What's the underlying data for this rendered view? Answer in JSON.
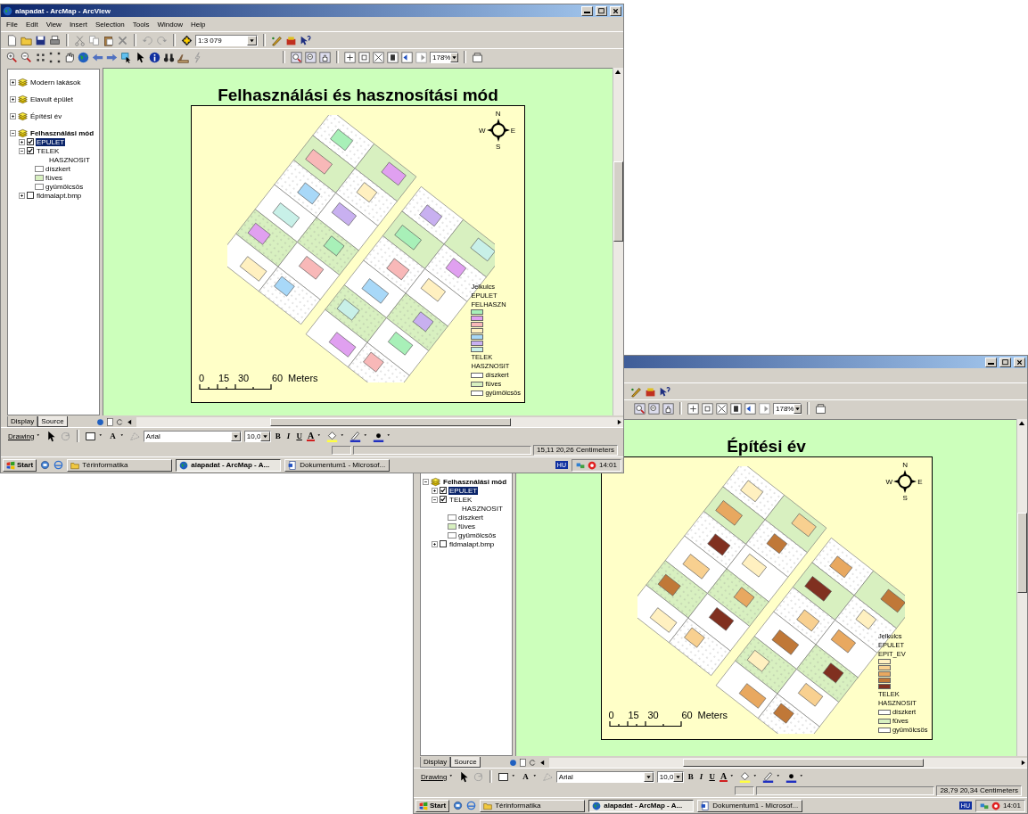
{
  "windows": [
    {
      "kind": "front",
      "title": "alapadat - ArcMap - ArcView",
      "menu": [
        "File",
        "Edit",
        "View",
        "Insert",
        "Selection",
        "Tools",
        "Window",
        "Help"
      ],
      "scale": "1:3 079",
      "zoom": "178%",
      "toc": [
        {
          "label": "Modern lakások",
          "kind": "frame",
          "expanded": false,
          "active": false
        },
        {
          "label": "Elavult épület",
          "kind": "frame",
          "expanded": false,
          "active": false
        },
        {
          "label": "Építési év",
          "kind": "frame",
          "expanded": false,
          "active": false
        },
        {
          "label": "Felhasználási mód",
          "kind": "frame",
          "expanded": true,
          "active": true,
          "children": [
            {
              "label": "EPULET",
              "kind": "layer",
              "expanded": false,
              "checked": true,
              "selected": true
            },
            {
              "label": "TELEK",
              "kind": "layer",
              "expanded": true,
              "checked": true,
              "selected": false,
              "children": [
                {
                  "kind": "heading",
                  "label": "HASZNOSIT"
                },
                {
                  "kind": "class",
                  "label": "díszkert",
                  "color": "#ffffff"
                },
                {
                  "kind": "class",
                  "label": "füves",
                  "color": "#d8f0c0"
                },
                {
                  "kind": "class",
                  "label": "gyümölcsös",
                  "color": "#ffffff"
                }
              ]
            },
            {
              "label": "fldmalapt.bmp",
              "kind": "layer",
              "expanded": false,
              "checked": false,
              "selected": false
            }
          ]
        }
      ],
      "toc_tabs": [
        {
          "label": "Display",
          "selected": false
        },
        {
          "label": "Source",
          "selected": true
        }
      ],
      "map_title": "Felhasználási és hasznosítási mód",
      "north_arrow": {
        "n": "N",
        "w": "W",
        "e": "E",
        "s": "S"
      },
      "scale_bar": [
        "0",
        "15",
        "30",
        "60",
        "Meters"
      ],
      "legend": [
        {
          "kind": "title",
          "label": "Jelkulcs"
        },
        {
          "kind": "heading",
          "label": "EPULET"
        },
        {
          "kind": "heading",
          "label": "FELHASZN"
        },
        {
          "kind": "swatch",
          "color": "#a8f0b8"
        },
        {
          "kind": "swatch",
          "color": "#e0a0f0"
        },
        {
          "kind": "swatch",
          "color": "#f8b8b8"
        },
        {
          "kind": "swatch",
          "color": "#fff0c0"
        },
        {
          "kind": "swatch",
          "color": "#a8d8f8"
        },
        {
          "kind": "swatch",
          "color": "#c8b0f0"
        },
        {
          "kind": "swatch",
          "color": "#c8f0e8"
        },
        {
          "kind": "heading",
          "label": "TELEK"
        },
        {
          "kind": "heading",
          "label": "HASZNOSIT"
        },
        {
          "kind": "class",
          "label": "díszkert",
          "color": "#ffffff"
        },
        {
          "kind": "class",
          "label": "füves",
          "color": "#d8f0c0"
        },
        {
          "kind": "class",
          "label": "gyümölcsös",
          "color": "#ffffff"
        }
      ],
      "drawing": {
        "menu": "Drawing",
        "text_tool": "A",
        "font": "Arial",
        "size": "10,0",
        "styles": [
          "B",
          "I",
          "U"
        ],
        "font_color": "A"
      },
      "status": "15,11 20,26 Centimeters",
      "taskbar": {
        "start": "Start",
        "tasks": [
          {
            "label": "Térinformatika",
            "kind": "folder",
            "selected": false
          },
          {
            "label": "alapadat - ArcMap - A...",
            "kind": "arcmap",
            "selected": true
          },
          {
            "label": "Dokumentum1 - Microsof...",
            "kind": "word",
            "selected": false
          }
        ],
        "language": "HU",
        "clock": "14:01"
      }
    },
    {
      "kind": "back",
      "zoom": "178%",
      "toc": [
        {
          "label": "Felhasználási mód",
          "kind": "frame",
          "expanded": true,
          "active": true,
          "children": [
            {
              "label": "EPULET",
              "kind": "layer",
              "expanded": false,
              "checked": true,
              "selected": true
            },
            {
              "label": "TELEK",
              "kind": "layer",
              "expanded": true,
              "checked": true,
              "selected": false,
              "children": [
                {
                  "kind": "heading",
                  "label": "HASZNOSIT"
                },
                {
                  "kind": "class",
                  "label": "díszkert",
                  "color": "#ffffff"
                },
                {
                  "kind": "class",
                  "label": "füves",
                  "color": "#d8f0c0"
                },
                {
                  "kind": "class",
                  "label": "gyümölcsös",
                  "color": "#ffffff"
                }
              ]
            },
            {
              "label": "fldmalapt.bmp",
              "kind": "layer",
              "expanded": false,
              "checked": false,
              "selected": false
            }
          ]
        }
      ],
      "toc_tabs": [
        {
          "label": "Display",
          "selected": false
        },
        {
          "label": "Source",
          "selected": true
        }
      ],
      "map_title": "Építési év",
      "north_arrow": {
        "n": "N",
        "w": "W",
        "e": "E",
        "s": "S"
      },
      "scale_bar": [
        "0",
        "15",
        "30",
        "60",
        "Meters"
      ],
      "legend": [
        {
          "kind": "title",
          "label": "Jelkulcs"
        },
        {
          "kind": "heading",
          "label": "EPULET"
        },
        {
          "kind": "heading",
          "label": "EPIT_EV"
        },
        {
          "kind": "swatch",
          "color": "#fff0c0"
        },
        {
          "kind": "swatch",
          "color": "#f8d090"
        },
        {
          "kind": "swatch",
          "color": "#e8a860"
        },
        {
          "kind": "swatch",
          "color": "#c07838"
        },
        {
          "kind": "swatch",
          "color": "#803020"
        },
        {
          "kind": "heading",
          "label": "TELEK"
        },
        {
          "kind": "heading",
          "label": "HASZNOSIT"
        },
        {
          "kind": "class",
          "label": "díszkert",
          "color": "#ffffff"
        },
        {
          "kind": "class",
          "label": "füves",
          "color": "#d8f0c0"
        },
        {
          "kind": "class",
          "label": "gyümölcsös",
          "color": "#ffffff"
        }
      ],
      "drawing": {
        "menu": "Drawing",
        "text_tool": "A",
        "font": "Arial",
        "size": "10,0",
        "styles": [
          "B",
          "I",
          "U"
        ],
        "font_color": "A"
      },
      "status": "28,79 20,34 Centimeters",
      "taskbar": {
        "start": "Start",
        "tasks": [
          {
            "label": "Térinformatika",
            "kind": "folder",
            "selected": false
          },
          {
            "label": "alapadat - ArcMap - A...",
            "kind": "arcmap",
            "selected": true
          },
          {
            "label": "Dokumentum1 - Microsof...",
            "kind": "word",
            "selected": false
          }
        ],
        "language": "HU",
        "clock": "14:01"
      }
    }
  ]
}
